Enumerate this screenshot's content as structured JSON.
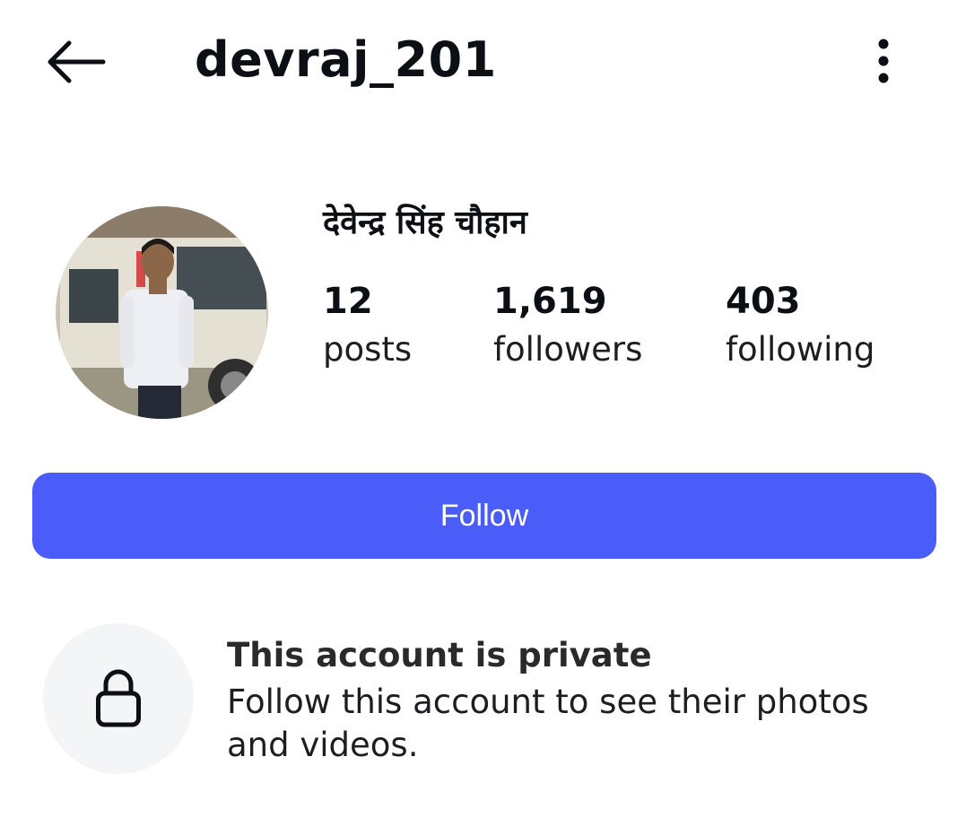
{
  "header": {
    "back_icon": "arrow-left-icon",
    "username": "devraj_201",
    "more_icon": "more-vertical-icon"
  },
  "profile": {
    "display_name": "देवेन्द्र सिंह चौहान",
    "stats": [
      {
        "value": "12",
        "label": "posts"
      },
      {
        "value": "1,619",
        "label": "followers"
      },
      {
        "value": "403",
        "label": "following"
      }
    ]
  },
  "actions": {
    "follow_label": "Follow"
  },
  "private_notice": {
    "icon": "lock-icon",
    "title": "This account is private",
    "description": "Follow this account to see their photos and videos."
  },
  "colors": {
    "follow_button": "#4a5df9",
    "lock_circle": "#f3f5f7",
    "text": "#0c1014"
  }
}
